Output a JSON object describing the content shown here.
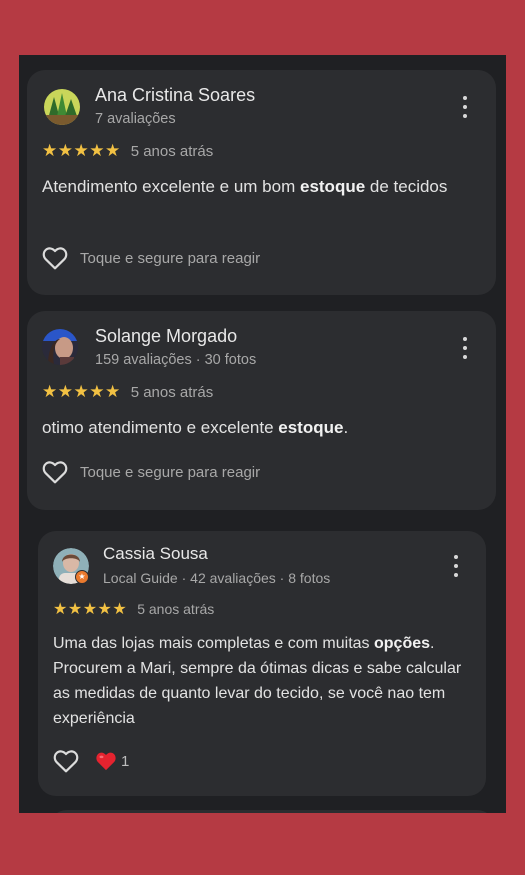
{
  "reviews": [
    {
      "name": "Ana Cristina Soares",
      "meta": "7 avaliações",
      "stars": "★★★★★",
      "when": "5 anos atrás",
      "text_parts": [
        "Atendimento excelente e um bom ",
        "estoque",
        " de tecidos"
      ],
      "react_label": "Toque e segure para reagir"
    },
    {
      "name": "Solange Morgado",
      "meta": "159 avaliações · 30 fotos",
      "stars": "★★★★★",
      "when": "5 anos atrás",
      "text_parts": [
        "otimo atendimento e excelente ",
        "estoque",
        "."
      ],
      "react_label": "Toque e segure para reagir"
    },
    {
      "name": "Cassia Sousa",
      "meta": "Local Guide · 42 avaliações · 8 fotos",
      "stars": "★★★★★",
      "when": "5 anos atrás",
      "text_parts": [
        "Uma das lojas mais completas e com muitas ",
        "opções",
        ". Procurem a Mari, sempre da ótimas dicas e sabe calcular as medidas de quanto levar do tecido, se você nao tem experiência"
      ],
      "reaction_emoji": "❤️",
      "reaction_count": "1"
    }
  ],
  "colors": {
    "background": "#b53a43",
    "screen": "#1f2023",
    "card": "#2c2d30",
    "star": "#f2c143"
  }
}
